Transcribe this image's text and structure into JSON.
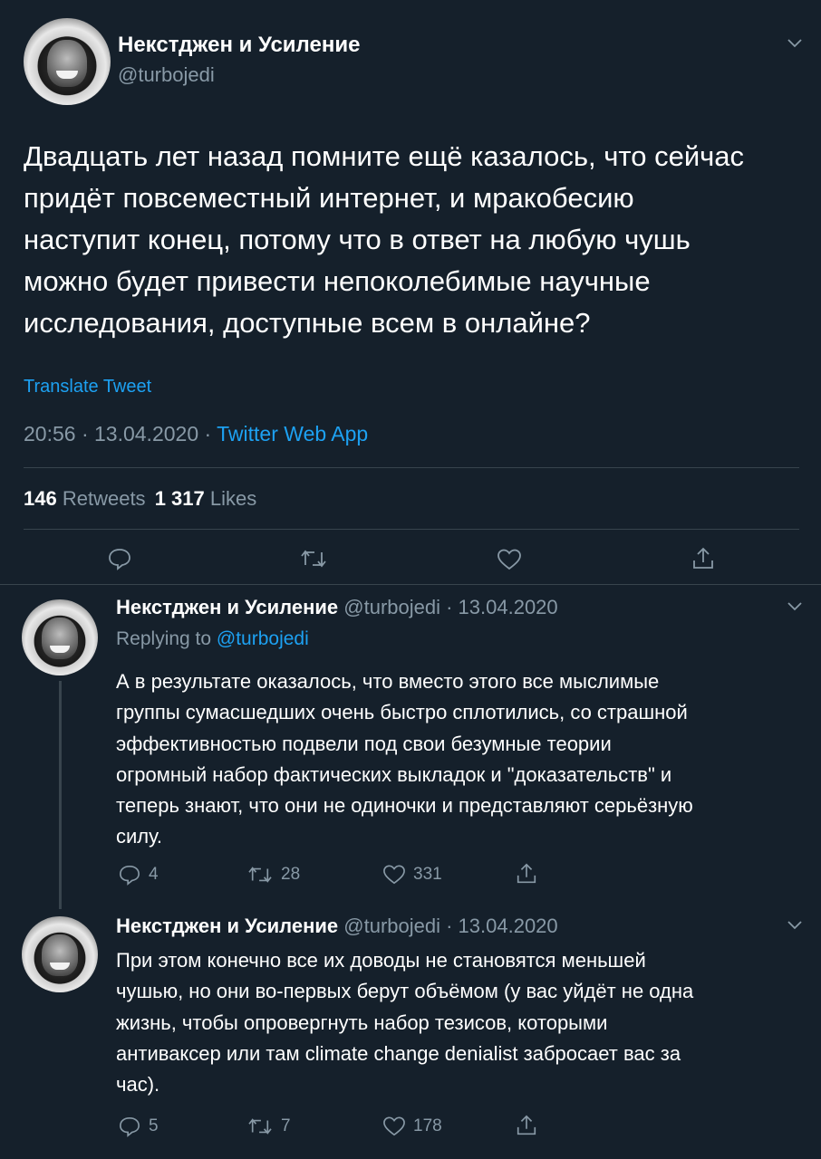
{
  "main_tweet": {
    "author_name": "Некстджен и Усиление",
    "handle": "@turbojedi",
    "text_lines": [
      "Двадцать лет назад помните ещё казалось, что сейчас",
      "придёт повсеместный интернет, и мракобесию",
      "наступит конец, потому что в ответ на любую чушь",
      "можно будет привести непоколебимые научные",
      "исследования, доступные всем в онлайне?"
    ],
    "translate_label": "Translate Tweet",
    "time": "20:56 · 13.04.2020 ·",
    "source": "Twitter Web App",
    "retweets_count": "146",
    "retweets_label": "Retweets",
    "likes_count": "1 317",
    "likes_label": "Likes"
  },
  "replies": [
    {
      "author_name": "Некстджен и Усиление",
      "handle_date": "@turbojedi · 13.04.2020",
      "replying_prefix": "Replying to",
      "replying_handle": "@turbojedi",
      "text_lines": [
        "А в результате оказалось, что вместо этого все мыслимые",
        "группы сумасшедших очень быстро сплотились, со страшной",
        "эффективностью подвели под свои безумные теории",
        "огромный набор фактических выкладок и \"доказательств\" и",
        "теперь знают, что они не одиночки и представляют серьёзную",
        "силу."
      ],
      "reply_count": "4",
      "retweet_count": "28",
      "like_count": "331"
    },
    {
      "author_name": "Некстджен и Усиление",
      "handle_date": "@turbojedi · 13.04.2020",
      "text_lines": [
        "При этом конечно все их доводы не становятся меньшей",
        "чушью, но они во-первых берут объёмом (у вас уйдёт не одна",
        "жизнь, чтобы опровергнуть набор тезисов, которыми",
        "антиваксер или там climate change denialist забросает вас за",
        "час)."
      ],
      "reply_count": "5",
      "retweet_count": "7",
      "like_count": "178"
    }
  ],
  "icons": {
    "reply": "reply-icon",
    "retweet": "retweet-icon",
    "like": "heart-icon",
    "share": "share-icon",
    "more": "chevron-down-icon"
  },
  "colors": {
    "background": "#15202b",
    "text": "#ffffff",
    "muted": "#8899a6",
    "accent": "#1da1f2",
    "divider": "#38444d"
  }
}
